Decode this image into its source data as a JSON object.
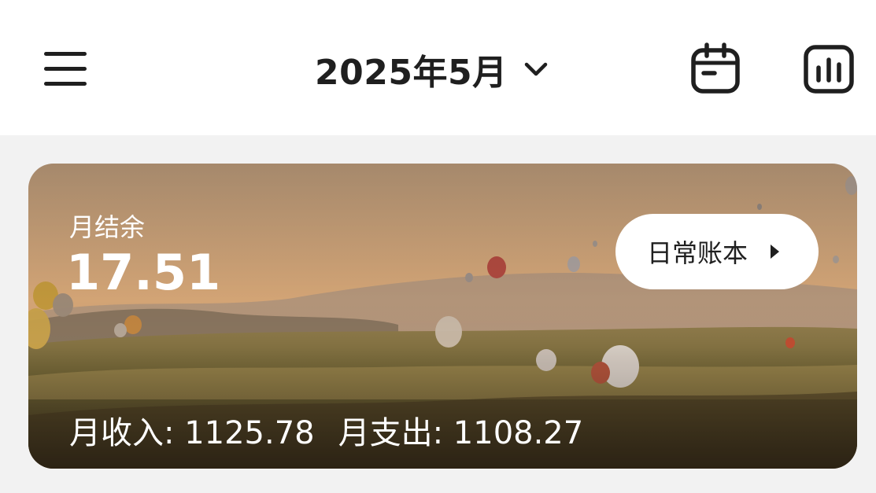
{
  "header": {
    "menu_icon": "menu-icon",
    "month": "2025年5月",
    "dropdown_icon": "chevron-down-icon",
    "calendar_icon": "calendar-icon",
    "stats_icon": "bar-chart-icon"
  },
  "card": {
    "background": "hot-air-balloons-landscape",
    "balance_label": "月结余",
    "balance_value": "17.51",
    "book_button": "日常账本",
    "book_arrow_icon": "caret-right-icon",
    "income_text": "月收入: 1125.78",
    "expense_text": "月支出: 1108.27"
  },
  "colors": {
    "page_bg": "#f2f2f2",
    "header_bg": "#ffffff",
    "text_dark": "#1f1f1f",
    "text_light": "#ffffff"
  }
}
